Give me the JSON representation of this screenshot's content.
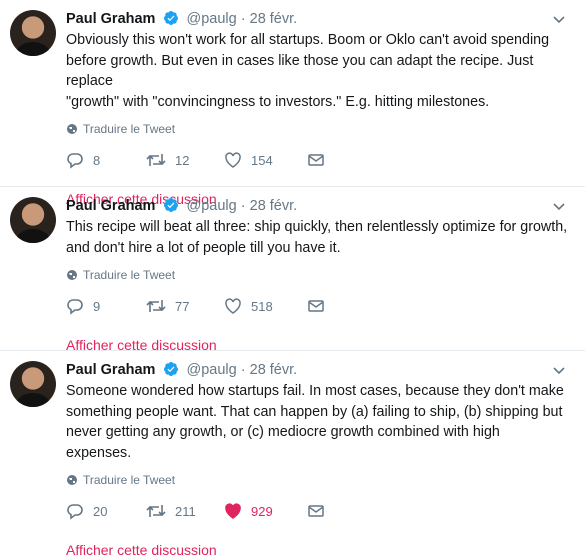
{
  "tweets": [
    {
      "author": "Paul Graham",
      "handle": "@paulg",
      "separator": "·",
      "date": "28 févr.",
      "text": "Obviously this won't work for all startups. Boom or Oklo can't avoid spending\nbefore growth. But even in cases like those you can adapt the recipe. Just replace\n\"growth\" with \"convincingness to investors.\" E.g. hitting milestones.",
      "translate": "Traduire le Tweet",
      "replies": "8",
      "retweets": "12",
      "likes": "154",
      "liked": false,
      "thread": "Afficher cette discussion"
    },
    {
      "author": "Paul Graham",
      "handle": "@paulg",
      "separator": "·",
      "date": "28 févr.",
      "text": "This recipe will beat all three: ship quickly, then relentlessly optimize for growth,\nand don't hire a lot of people till you have it.",
      "translate": "Traduire le Tweet",
      "replies": "9",
      "retweets": "77",
      "likes": "518",
      "liked": false,
      "thread": "Afficher cette discussion"
    },
    {
      "author": "Paul Graham",
      "handle": "@paulg",
      "separator": "·",
      "date": "28 févr.",
      "text": "Someone wondered how startups fail. In most cases, because they don't make\nsomething people want. That can happen by (a) failing to ship, (b) shipping but\nnever getting any growth, or (c) mediocre growth combined with high expenses.",
      "translate": "Traduire le Tweet",
      "replies": "20",
      "retweets": "211",
      "likes": "929",
      "liked": true,
      "thread": "Afficher cette discussion"
    }
  ],
  "colors": {
    "verified": "#1da1f2",
    "like_active": "#e0245e",
    "thread_link": "#e0245e",
    "muted": "#657786"
  },
  "icons": [
    "verified-badge-icon",
    "chevron-down-icon",
    "globe-icon",
    "reply-icon",
    "retweet-icon",
    "heart-icon",
    "message-icon"
  ]
}
